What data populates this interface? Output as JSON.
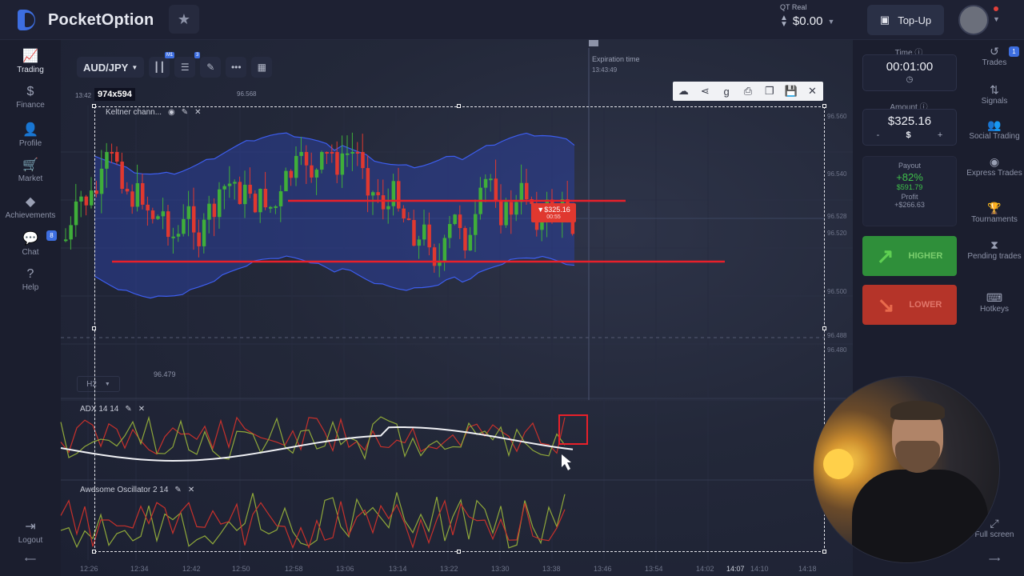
{
  "header": {
    "logo_text": "PocketOption",
    "account_type": "QT Real",
    "balance": "$0.00",
    "topup_label": "Top-Up"
  },
  "left_nav": [
    {
      "label": "Trading",
      "icon": "chart-line-icon",
      "glyph": "📈",
      "active": true
    },
    {
      "label": "Finance",
      "icon": "dollar-icon",
      "glyph": "$"
    },
    {
      "label": "Profile",
      "icon": "user-icon",
      "glyph": "👤"
    },
    {
      "label": "Market",
      "icon": "cart-icon",
      "glyph": "🛒"
    },
    {
      "label": "Achievements",
      "icon": "diamond-icon",
      "glyph": "◆"
    },
    {
      "label": "Chat",
      "icon": "chat-icon",
      "glyph": "💬",
      "badge": "8"
    },
    {
      "label": "Help",
      "icon": "help-icon",
      "glyph": "?"
    },
    {
      "label": "Logout",
      "icon": "logout-icon",
      "glyph": "⇥"
    }
  ],
  "chart": {
    "asset": "AUD/JPY",
    "timeframe": "H2",
    "selection_size": "974x594",
    "top_time_label": "13:42",
    "top_price_label": "96.568",
    "low_price_label": "96.479",
    "expiration_label": "Expiration time",
    "expiration_time": "13:43:49",
    "trade_marker_amount": "$325.16",
    "trade_marker_timer": "00:55",
    "keltner_label": "Keltner chann...",
    "adx_label": "ADX 14 14",
    "ao_label": "Awesome Oscillator 2 14",
    "badge_m1": "M1",
    "badge_3": "3",
    "price_scale": [
      "96.560",
      "96.540",
      "96.528",
      "96.520",
      "96.500",
      "96.488",
      "96.480"
    ],
    "time_axis": [
      "12:26",
      "12:34",
      "12:42",
      "12:50",
      "12:58",
      "13:06",
      "13:14",
      "13:22",
      "13:30",
      "13:38",
      "13:46",
      "13:54",
      "14:02",
      "14:07",
      "14:10",
      "14:18"
    ]
  },
  "right_panel": {
    "time_label": "Time",
    "time_value": "00:01:00",
    "amount_label": "Amount",
    "amount_value": "$325.16",
    "amount_minus": "-",
    "amount_currency": "$",
    "amount_plus": "+",
    "payout_label": "Payout",
    "payout_pct": "+82%",
    "payout_value": "$591.79",
    "profit_label": "Profit",
    "profit_value": "+$266.63",
    "higher_label": "HIGHER",
    "lower_label": "LOWER"
  },
  "right_nav": [
    {
      "label": "Trades",
      "icon": "history-icon",
      "glyph": "↺",
      "badge": "1"
    },
    {
      "label": "Signals",
      "icon": "signal-icon",
      "glyph": "⇅"
    },
    {
      "label": "Social Trading",
      "icon": "people-icon",
      "glyph": "👥"
    },
    {
      "label": "Express Trades",
      "icon": "express-icon",
      "glyph": "◉"
    },
    {
      "label": "Tournaments",
      "icon": "trophy-icon",
      "glyph": "🏆"
    },
    {
      "label": "Pending trades",
      "icon": "hourglass-icon",
      "glyph": "⧗"
    },
    {
      "label": "Hotkeys",
      "icon": "keyboard-icon",
      "glyph": "⌨"
    },
    {
      "label": "Full screen",
      "icon": "fullscreen-icon",
      "glyph": "⤢"
    }
  ],
  "colors": {
    "bull": "#3fae3a",
    "bear": "#e0382f",
    "keltner_fill": "#2b3f9a",
    "level_line": "#e8202a",
    "higher_bg": "#2f8f3a",
    "lower_bg": "#b53429"
  }
}
